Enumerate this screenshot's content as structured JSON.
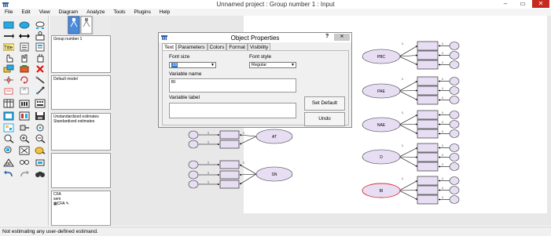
{
  "window": {
    "title": "Unnamed project : Group number 1 : Input",
    "minimize": "–",
    "maximize": "▭",
    "close": "✕"
  },
  "menu": [
    "File",
    "Edit",
    "View",
    "Diagram",
    "Analyze",
    "Tools",
    "Plugins",
    "Help"
  ],
  "panel": {
    "groups": "Group number 1",
    "models": "Default model",
    "estimates": [
      "Unstandardized estimates",
      "Standardized estimates"
    ],
    "files": [
      "CFA",
      "sem",
      "CFA"
    ]
  },
  "dialog": {
    "title": "Object Properties",
    "help": "?",
    "close": "✕",
    "tabs": [
      "Text",
      "Parameters",
      "Colors",
      "Format",
      "Visibility"
    ],
    "font_size_label": "Font size",
    "font_size_value": "18",
    "font_style_label": "Font style",
    "font_style_value": "Regular",
    "variable_name_label": "Variable name",
    "variable_name_value": "BI",
    "variable_label_label": "Variable label",
    "variable_label_value": "",
    "set_default": "Set Default",
    "undo": "Undo"
  },
  "diagram": {
    "latents": [
      "PBC",
      "PAE",
      "NAE",
      "D",
      "BI",
      "AT",
      "SN"
    ],
    "path_weight": "1"
  },
  "colors": {
    "latent_fill": "#e7def4",
    "observed_fill": "#e7def4",
    "selected_outline": "#e03030",
    "close_red": "#c42b1c"
  },
  "status": "Not estimating any user-defined estimand."
}
